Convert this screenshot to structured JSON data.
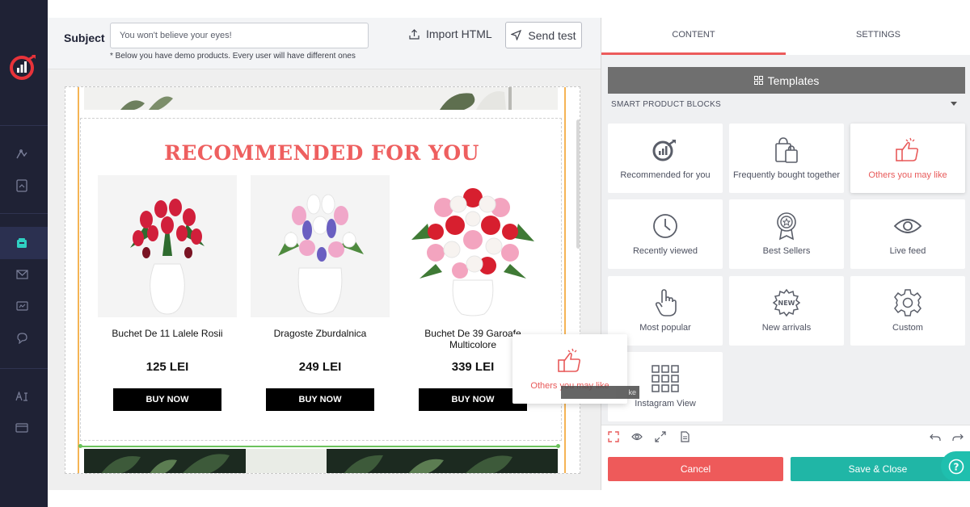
{
  "nav": {
    "icons": [
      "app-logo",
      "analytics-icon",
      "reports-icon",
      "campaigns-icon",
      "email-icon",
      "sms-icon",
      "chat-icon",
      "ai-icon",
      "card-icon"
    ]
  },
  "editor": {
    "subject_label": "Subject",
    "subject_value": "You won't believe your eyes!",
    "subject_note": "* Below you have demo products. Every user will have different ones",
    "import_label": "Import HTML",
    "send_test_label": "Send test"
  },
  "email": {
    "title": "RECOMMENDED FOR YOU",
    "products": [
      {
        "name": "Buchet De 11 Lalele Rosii",
        "price": "125 LEI",
        "cta": "BUY NOW"
      },
      {
        "name": "Dragoste Zburdalnica",
        "price": "249 LEI",
        "cta": "BUY NOW"
      },
      {
        "name": "Buchet De 39 Garoafe Multicolore",
        "price": "339 LEI",
        "cta": "BUY NOW"
      }
    ]
  },
  "drag": {
    "label": "Others you may like",
    "tooltip": "ke"
  },
  "panel": {
    "tabs": [
      "CONTENT",
      "SETTINGS"
    ],
    "active_tab": "CONTENT",
    "templates_label": "Templates",
    "section_title": "SMART PRODUCT BLOCKS",
    "blocks": [
      {
        "label": "Recommended for you",
        "icon": "logo-icon"
      },
      {
        "label": "Frequently bought together",
        "icon": "shopping-bags-icon"
      },
      {
        "label": "Others you may like",
        "icon": "thumbs-up-icon"
      },
      {
        "label": "Recently viewed",
        "icon": "clock-icon"
      },
      {
        "label": "Best Sellers",
        "icon": "award-badge-icon"
      },
      {
        "label": "Live feed",
        "icon": "eye-icon"
      },
      {
        "label": "Most popular",
        "icon": "pointer-hand-icon"
      },
      {
        "label": "New arrivals",
        "icon": "new-badge-icon"
      },
      {
        "label": "Custom",
        "icon": "gear-icon"
      },
      {
        "label": "Instagram View",
        "icon": "grid-icon"
      }
    ],
    "cancel_label": "Cancel",
    "save_label": "Save & Close",
    "help_label": "?"
  },
  "colors": {
    "accent_red": "#ee5a5a",
    "teal": "#20b6a6",
    "nav_bg": "#1f2235"
  }
}
